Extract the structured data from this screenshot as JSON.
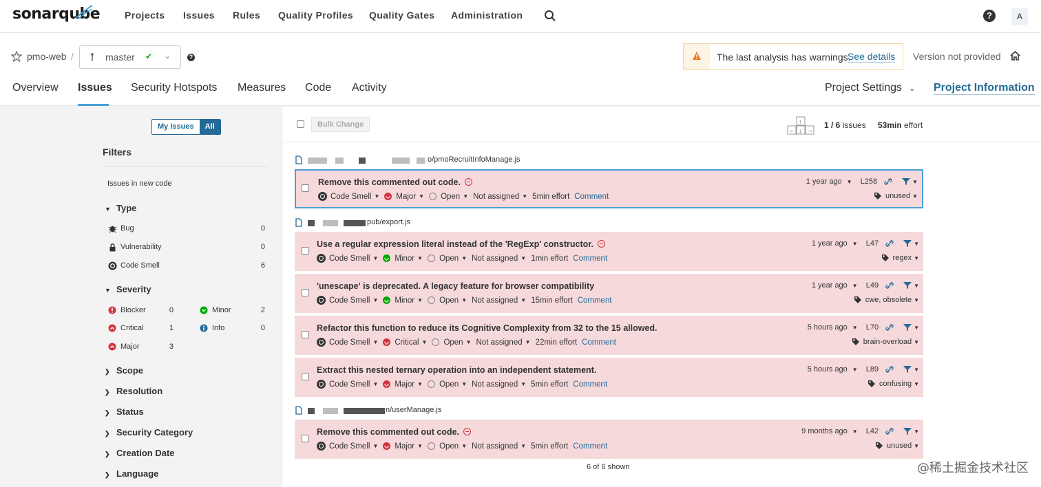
{
  "topnav": {
    "logo": "sonarqube",
    "items": [
      "Projects",
      "Issues",
      "Rules",
      "Quality Profiles",
      "Quality Gates",
      "Administration"
    ],
    "avatar": "A"
  },
  "project": {
    "name": "pmo-web",
    "separator": "/",
    "branch": "master",
    "warning_text": "The last analysis has warnings.",
    "warning_link": "See details",
    "version": "Version not provided",
    "tabs": [
      "Overview",
      "Issues",
      "Security Hotspots",
      "Measures",
      "Code",
      "Activity"
    ],
    "settings": "Project Settings",
    "info": "Project Information"
  },
  "sidebar": {
    "my_issues": "My Issues",
    "all": "All",
    "filters_title": "Filters",
    "new_code": "Issues in new code",
    "type_title": "Type",
    "types": [
      {
        "label": "Bug",
        "count": "0",
        "icon": "bug-icon"
      },
      {
        "label": "Vulnerability",
        "count": "0",
        "icon": "lock-icon"
      },
      {
        "label": "Code Smell",
        "count": "6",
        "icon": "code-smell-icon"
      }
    ],
    "severity_title": "Severity",
    "severities": [
      {
        "label": "Blocker",
        "count": "0"
      },
      {
        "label": "Minor",
        "count": "2"
      },
      {
        "label": "Critical",
        "count": "1"
      },
      {
        "label": "Info",
        "count": "0"
      },
      {
        "label": "Major",
        "count": "3"
      }
    ],
    "facets": [
      "Scope",
      "Resolution",
      "Status",
      "Security Category",
      "Creation Date",
      "Language"
    ]
  },
  "toolbar": {
    "bulk": "Bulk Change",
    "count_prefix": "1 / 6",
    "count_suffix": "issues",
    "effort_value": "53min",
    "effort_label": "effort"
  },
  "files": [
    {
      "path": "o/pmoRecruitInfoManage.js"
    },
    {
      "path": "pub/export.js"
    },
    {
      "path": "n/userManage.js"
    }
  ],
  "issues": [
    {
      "msg": "Remove this commented out code.",
      "type": "Code Smell",
      "severity": "Major",
      "status": "Open",
      "assignee": "Not assigned",
      "effort": "5min effort",
      "comment": "Comment",
      "age": "1 year ago",
      "line": "L258",
      "tags": "unused"
    },
    {
      "msg": "Use a regular expression literal instead of the 'RegExp' constructor.",
      "type": "Code Smell",
      "severity": "Minor",
      "status": "Open",
      "assignee": "Not assigned",
      "effort": "1min effort",
      "comment": "Comment",
      "age": "1 year ago",
      "line": "L47",
      "tags": "regex"
    },
    {
      "msg": "'unescape' is deprecated. A legacy feature for browser compatibility",
      "type": "Code Smell",
      "severity": "Minor",
      "status": "Open",
      "assignee": "Not assigned",
      "effort": "15min effort",
      "comment": "Comment",
      "age": "1 year ago",
      "line": "L49",
      "tags": "cwe, obsolete"
    },
    {
      "msg": "Refactor this function to reduce its Cognitive Complexity from 32 to the 15 allowed.",
      "type": "Code Smell",
      "severity": "Critical",
      "status": "Open",
      "assignee": "Not assigned",
      "effort": "22min effort",
      "comment": "Comment",
      "age": "5 hours ago",
      "line": "L70",
      "tags": "brain-overload"
    },
    {
      "msg": "Extract this nested ternary operation into an independent statement.",
      "type": "Code Smell",
      "severity": "Major",
      "status": "Open",
      "assignee": "Not assigned",
      "effort": "5min effort",
      "comment": "Comment",
      "age": "5 hours ago",
      "line": "L89",
      "tags": "confusing"
    },
    {
      "msg": "Remove this commented out code.",
      "type": "Code Smell",
      "severity": "Major",
      "status": "Open",
      "assignee": "Not assigned",
      "effort": "5min effort",
      "comment": "Comment",
      "age": "9 months ago",
      "line": "L42",
      "tags": "unused"
    }
  ],
  "footer": {
    "shown": "6 of 6 shown"
  },
  "watermark": "@稀土掘金技术社区"
}
